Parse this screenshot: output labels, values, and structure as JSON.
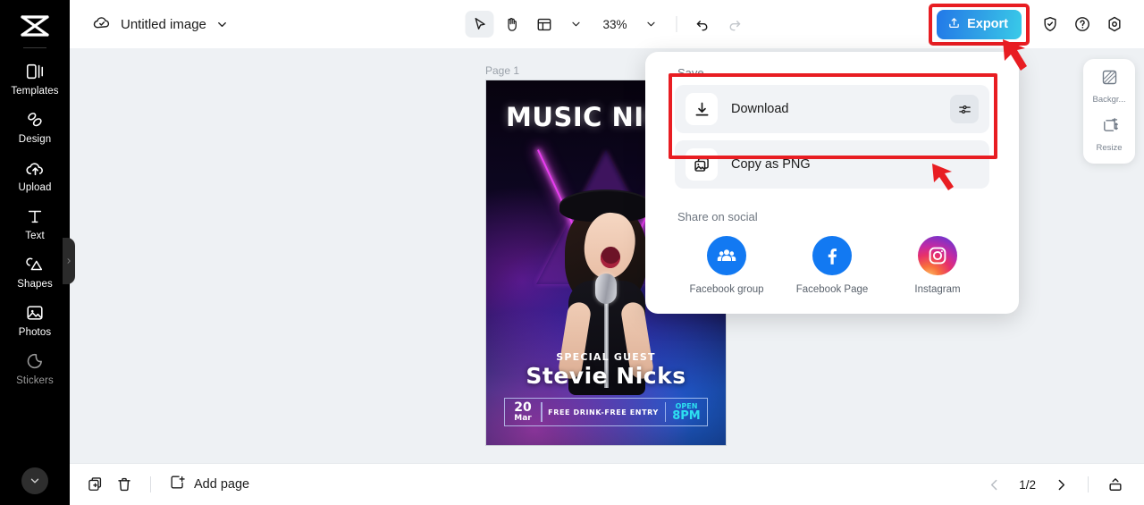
{
  "sidebar": {
    "logo_icon": "capcut-logo-icon",
    "items": [
      {
        "label": "Templates",
        "icon": "templates-icon",
        "dim": false
      },
      {
        "label": "Design",
        "icon": "design-icon",
        "dim": false
      },
      {
        "label": "Upload",
        "icon": "upload-cloud-icon",
        "dim": false
      },
      {
        "label": "Text",
        "icon": "text-icon",
        "dim": false
      },
      {
        "label": "Shapes",
        "icon": "shapes-icon",
        "dim": false
      },
      {
        "label": "Photos",
        "icon": "photos-icon",
        "dim": false
      },
      {
        "label": "Stickers",
        "icon": "stickers-icon",
        "dim": true
      }
    ],
    "more_icon": "chevron-down-icon",
    "collapse_icon": "chevron-right-icon"
  },
  "topbar": {
    "cloud_icon": "cloud-saved-icon",
    "doc_title": "Untitled image",
    "title_caret_icon": "chevron-down-icon",
    "tools": [
      {
        "name": "select-tool",
        "icon": "cursor-arrow-icon",
        "active": true
      },
      {
        "name": "hand-tool",
        "icon": "hand-icon",
        "active": false
      },
      {
        "name": "layout-tool",
        "icon": "layout-icon",
        "active": false
      }
    ],
    "layout_caret_icon": "chevron-down-icon",
    "zoom_value": "33%",
    "zoom_caret_icon": "chevron-down-icon",
    "undo_icon": "undo-icon",
    "redo_icon": "redo-icon",
    "export_label": "Export",
    "export_icon": "upload-box-icon",
    "export_highlight_color": "#e81d22",
    "right_icons": [
      {
        "name": "shield-check-icon"
      },
      {
        "name": "help-circle-icon"
      },
      {
        "name": "settings-hex-icon"
      }
    ]
  },
  "canvas": {
    "page_label": "Page 1",
    "poster": {
      "title": "MUSIC NIGHT",
      "guest_label": "SPECIAL GUEST",
      "artist": "Stevie Nicks",
      "date_day": "20",
      "date_month": "Mar",
      "promo": "FREE DRINK-FREE ENTRY",
      "open_label": "OPEN",
      "open_time": "8PM"
    }
  },
  "right_panel": {
    "items": [
      {
        "label": "Backgr...",
        "icon": "background-icon"
      },
      {
        "label": "Resize",
        "icon": "resize-icon"
      }
    ]
  },
  "export_menu": {
    "save_title": "Save",
    "rows": [
      {
        "label": "Download",
        "icon": "download-icon",
        "action_icon": "sliders-icon",
        "has_action": true
      },
      {
        "label": "Copy as PNG",
        "icon": "copy-image-icon",
        "action_icon": "",
        "has_action": false
      }
    ],
    "social_title": "Share on social",
    "social": [
      {
        "label": "Facebook group",
        "icon": "facebook-group-icon"
      },
      {
        "label": "Facebook Page",
        "icon": "facebook-page-icon"
      },
      {
        "label": "Instagram",
        "icon": "instagram-icon"
      }
    ],
    "highlight_color": "#e81d22"
  },
  "bottombar": {
    "duplicate_icon": "duplicate-page-icon",
    "delete_icon": "trash-icon",
    "add_page_label": "Add page",
    "add_page_icon": "add-page-icon",
    "prev_icon": "chevron-left-icon",
    "page_count": "1/2",
    "next_icon": "chevron-right-icon",
    "panel_toggle_icon": "show-pages-icon"
  }
}
